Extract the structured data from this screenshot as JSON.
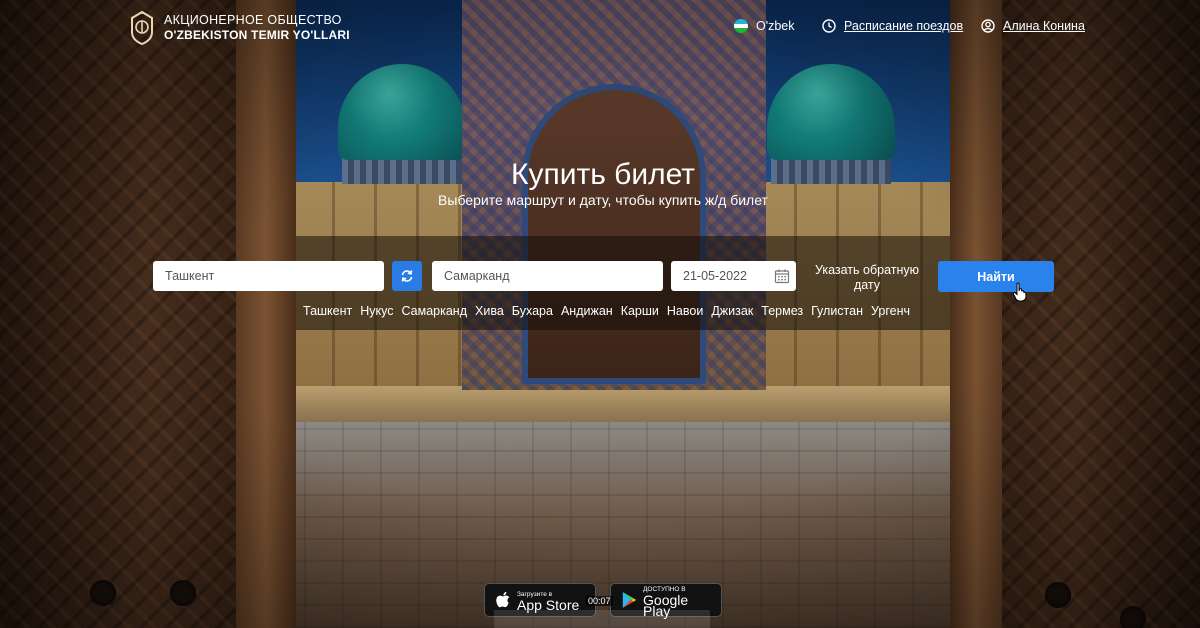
{
  "header": {
    "logo_line1": "АКЦИОНЕРНОЕ ОБЩЕСТВО",
    "logo_line2": "O'ZBEKISTON TEMIR YO'LLARI",
    "language_label": "O'zbek",
    "schedule_link": "Расписание поездов",
    "user_name": "Алина Конина"
  },
  "hero": {
    "title": "Купить билет",
    "subtitle": "Выберите маршрут и дату, чтобы купить ж/д билет"
  },
  "search": {
    "from_value": "Ташкент",
    "to_value": "Самарканд",
    "date_value": "21-05-2022",
    "return_date_label": "Указать обратную дату",
    "search_button": "Найти"
  },
  "cities": [
    "Ташкент",
    "Нукус",
    "Самарканд",
    "Хива",
    "Бухара",
    "Андижан",
    "Карши",
    "Навои",
    "Джизак",
    "Термез",
    "Гулистан",
    "Ургенч"
  ],
  "apps": {
    "apple_small": "Загрузите в",
    "apple_big": "App Store",
    "google_small": "ДОСТУПНО В",
    "google_big": "Google Play",
    "video_time": "00:07"
  },
  "colors": {
    "accent": "#2a82ec",
    "swap_button": "#2a7be4"
  },
  "icons": {
    "logo": "railway-emblem-icon",
    "language": "uzbekistan-flag-icon",
    "schedule": "clock-icon",
    "user": "user-circle-icon",
    "swap": "swap-arrows-icon",
    "date": "calendar-icon",
    "apple": "apple-icon",
    "google": "google-play-icon"
  }
}
